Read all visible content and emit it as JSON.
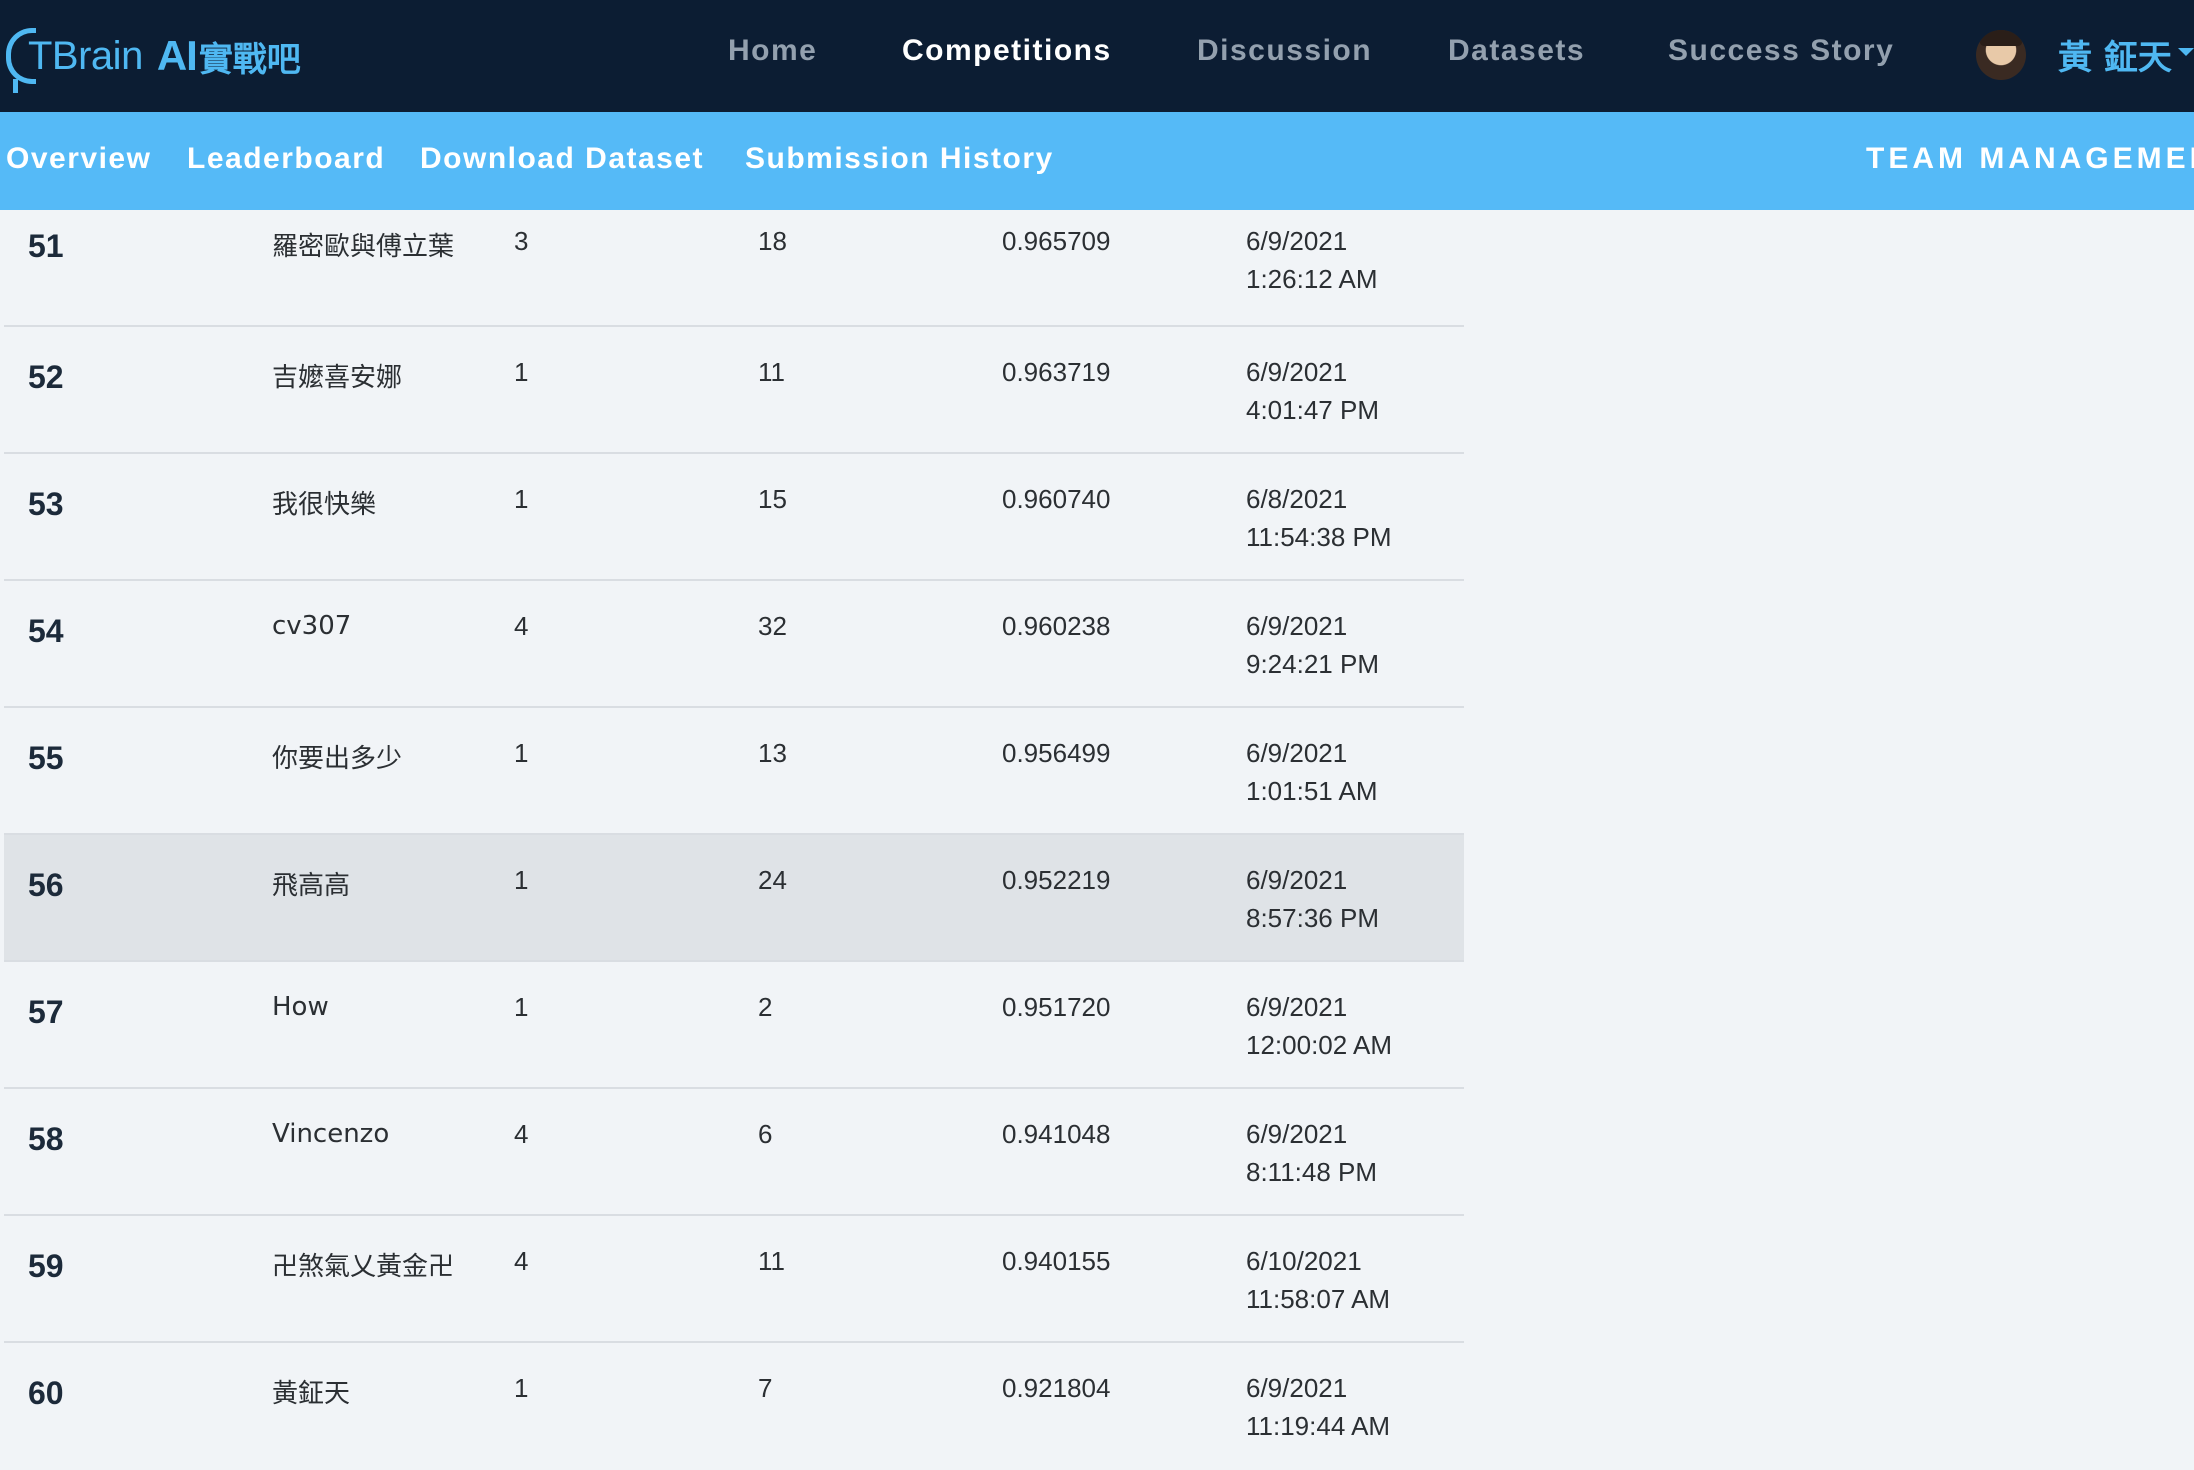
{
  "nav": {
    "logo_text": "TBrain",
    "logo_ai": "AI",
    "logo_zh": "實戰吧",
    "links": [
      {
        "label": "Home",
        "active": false
      },
      {
        "label": "Competitions",
        "active": true
      },
      {
        "label": "Discussion",
        "active": false
      },
      {
        "label": "Datasets",
        "active": false
      },
      {
        "label": "Success Story",
        "active": false
      }
    ],
    "user_name": "黃 鉦天"
  },
  "subnav": {
    "tabs": [
      {
        "label": "Overview"
      },
      {
        "label": "Leaderboard"
      },
      {
        "label": "Download Dataset"
      },
      {
        "label": "Submission History"
      }
    ],
    "team_management": "TEAM MANAGEMENT"
  },
  "leaderboard": {
    "rows": [
      {
        "rank": "51",
        "team": "羅密歐與傅立葉",
        "members": "3",
        "entries": "18",
        "score": "0.965709",
        "date": "6/9/2021",
        "time": "1:26:12 AM"
      },
      {
        "rank": "52",
        "team": "吉嬤喜安娜",
        "members": "1",
        "entries": "11",
        "score": "0.963719",
        "date": "6/9/2021",
        "time": "4:01:47 PM"
      },
      {
        "rank": "53",
        "team": "我很快樂",
        "members": "1",
        "entries": "15",
        "score": "0.960740",
        "date": "6/8/2021",
        "time": "11:54:38 PM"
      },
      {
        "rank": "54",
        "team": "cv307",
        "members": "4",
        "entries": "32",
        "score": "0.960238",
        "date": "6/9/2021",
        "time": "9:24:21 PM"
      },
      {
        "rank": "55",
        "team": "你要出多少",
        "members": "1",
        "entries": "13",
        "score": "0.956499",
        "date": "6/9/2021",
        "time": "1:01:51 AM"
      },
      {
        "rank": "56",
        "team": "飛高高",
        "members": "1",
        "entries": "24",
        "score": "0.952219",
        "date": "6/9/2021",
        "time": "8:57:36 PM"
      },
      {
        "rank": "57",
        "team": "How",
        "members": "1",
        "entries": "2",
        "score": "0.951720",
        "date": "6/9/2021",
        "time": "12:00:02 AM"
      },
      {
        "rank": "58",
        "team": "Vincenzo",
        "members": "4",
        "entries": "6",
        "score": "0.941048",
        "date": "6/9/2021",
        "time": "8:11:48 PM"
      },
      {
        "rank": "59",
        "team": "卍煞氣乂黃金卍",
        "members": "4",
        "entries": "11",
        "score": "0.940155",
        "date": "6/10/2021",
        "time": "11:58:07 AM"
      },
      {
        "rank": "60",
        "team": "黃鉦天",
        "members": "1",
        "entries": "7",
        "score": "0.921804",
        "date": "6/9/2021",
        "time": "11:19:44 AM"
      }
    ]
  }
}
